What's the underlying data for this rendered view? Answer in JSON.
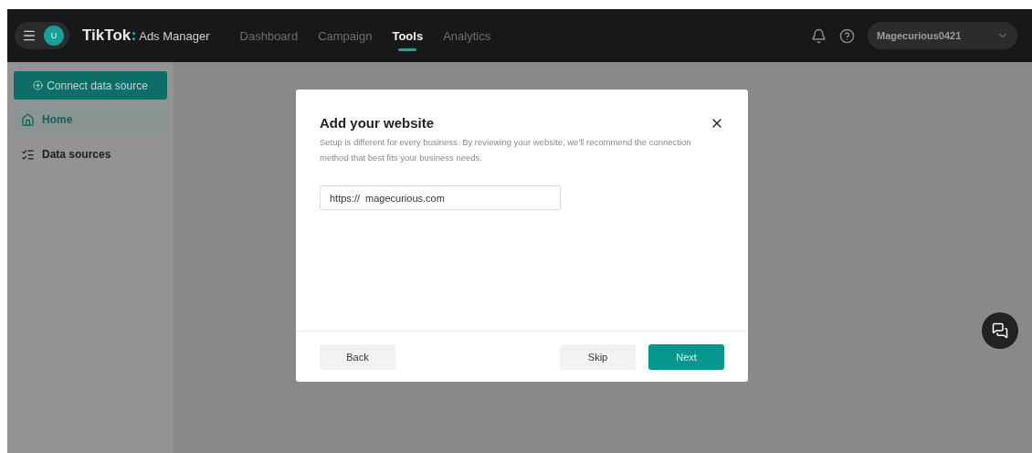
{
  "header": {
    "avatar": "U",
    "brand": "TikTok",
    "product": "Ads Manager",
    "nav": [
      {
        "label": "Dashboard",
        "selected": false
      },
      {
        "label": "Campaign",
        "selected": false
      },
      {
        "label": "Tools",
        "selected": true
      },
      {
        "label": "Analytics",
        "selected": false
      }
    ],
    "account": "Magecurious0421"
  },
  "sidebar": {
    "connect_button": "Connect data source",
    "items": [
      {
        "label": "Home",
        "selected": true
      },
      {
        "label": "Data sources",
        "selected": false
      }
    ]
  },
  "modal": {
    "title": "Add your website",
    "description": "Setup is different for every business. By reviewing your website, we'll recommend the connection method that best fits your business needs.",
    "url_prefix": "https://",
    "url_value": "magecurious.com",
    "buttons": [
      {
        "label": "Back",
        "kind": "secondary"
      },
      {
        "label": "Skip",
        "kind": "secondary"
      },
      {
        "label": "Next",
        "kind": "primary"
      }
    ]
  }
}
